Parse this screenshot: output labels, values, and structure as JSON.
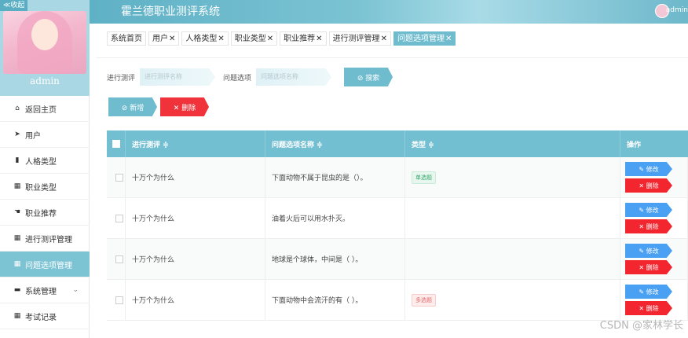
{
  "sidebar": {
    "collapse_label": "≪收起",
    "admin_name": "admin",
    "items": [
      {
        "label": "返回主页",
        "icon": "home-icon",
        "glyph": "⌂"
      },
      {
        "label": "用户",
        "icon": "send-icon",
        "glyph": "➤"
      },
      {
        "label": "人格类型",
        "icon": "book-icon",
        "glyph": "▮"
      },
      {
        "label": "职业类型",
        "icon": "grid-icon",
        "glyph": "▦"
      },
      {
        "label": "职业推荐",
        "icon": "thumb-icon",
        "glyph": "☚"
      },
      {
        "label": "进行测评管理",
        "icon": "grid-icon",
        "glyph": "▦"
      },
      {
        "label": "问题选项管理",
        "icon": "grid-icon",
        "glyph": "▦",
        "active": true
      },
      {
        "label": "系统管理",
        "icon": "chat-icon",
        "glyph": "▬",
        "chevron": "⌄"
      },
      {
        "label": "考试记录",
        "icon": "grid-icon",
        "glyph": "▦"
      }
    ]
  },
  "header": {
    "title": "霍兰德职业测评系统",
    "user": "admin"
  },
  "tabs": [
    {
      "label": "系统首页",
      "close": ""
    },
    {
      "label": "用户",
      "close": "✕"
    },
    {
      "label": "人格类型",
      "close": "✕"
    },
    {
      "label": "职业类型",
      "close": "✕"
    },
    {
      "label": "职业推荐",
      "close": "✕"
    },
    {
      "label": "进行测评管理",
      "close": "✕"
    },
    {
      "label": "问题选项管理",
      "close": "✕",
      "active": true
    }
  ],
  "search": {
    "label1": "进行测评",
    "placeholder1": "进行测评名称",
    "label2": "问题选项",
    "placeholder2": "问题选项名称",
    "button": "⊘ 搜索"
  },
  "actions": {
    "add": "⊘ 新增",
    "delete": "✕ 删除"
  },
  "table": {
    "headers": [
      "进行测评 ≑",
      "问题选项名称 ≑",
      "类型 ≑",
      "操作"
    ],
    "edit_label": "✎ 修改",
    "delete_label": "✕ 删除",
    "rows": [
      {
        "eval": "十万个为什么",
        "question": "下面动物不属于昆虫的是（）。",
        "type": "单选题",
        "type_kind": "single"
      },
      {
        "eval": "十万个为什么",
        "question": "油着火后可以用水扑灭。",
        "type": "",
        "type_kind": ""
      },
      {
        "eval": "十万个为什么",
        "question": "地球是个球体，中间是（ ）。",
        "type": "",
        "type_kind": ""
      },
      {
        "eval": "十万个为什么",
        "question": "下面动物中会流汗的有（ ）。",
        "type": "多选题",
        "type_kind": "multi"
      }
    ]
  },
  "watermark": "CSDN @家林学长"
}
